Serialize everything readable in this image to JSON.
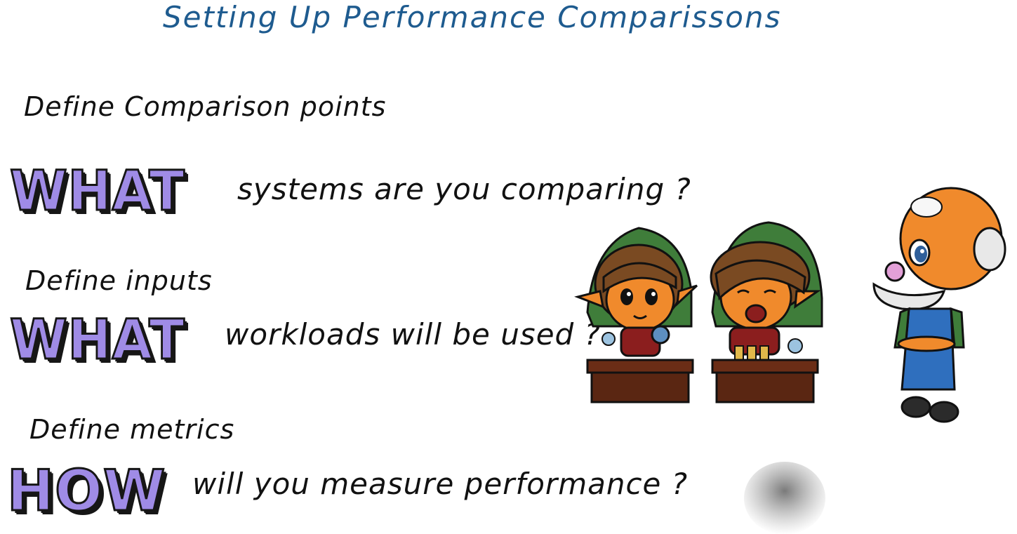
{
  "title": "Setting Up Performance Comparissons",
  "sections": [
    {
      "label": "Define Comparison points",
      "keyword": "WHAT",
      "question": "systems are you comparing ?"
    },
    {
      "label": "Define inputs",
      "keyword": "WHAT",
      "question": "workloads will be used ?"
    },
    {
      "label": "Define metrics",
      "keyword": "HOW",
      "question": "will you measure performance ?"
    }
  ],
  "colors": {
    "title": "#1e5b8f",
    "keyword_fill": "#9f8be6",
    "ink": "#111111"
  },
  "icons": {
    "illustration": "elf-workers-and-old-man-illustration",
    "smudge": "hand-shadow"
  }
}
